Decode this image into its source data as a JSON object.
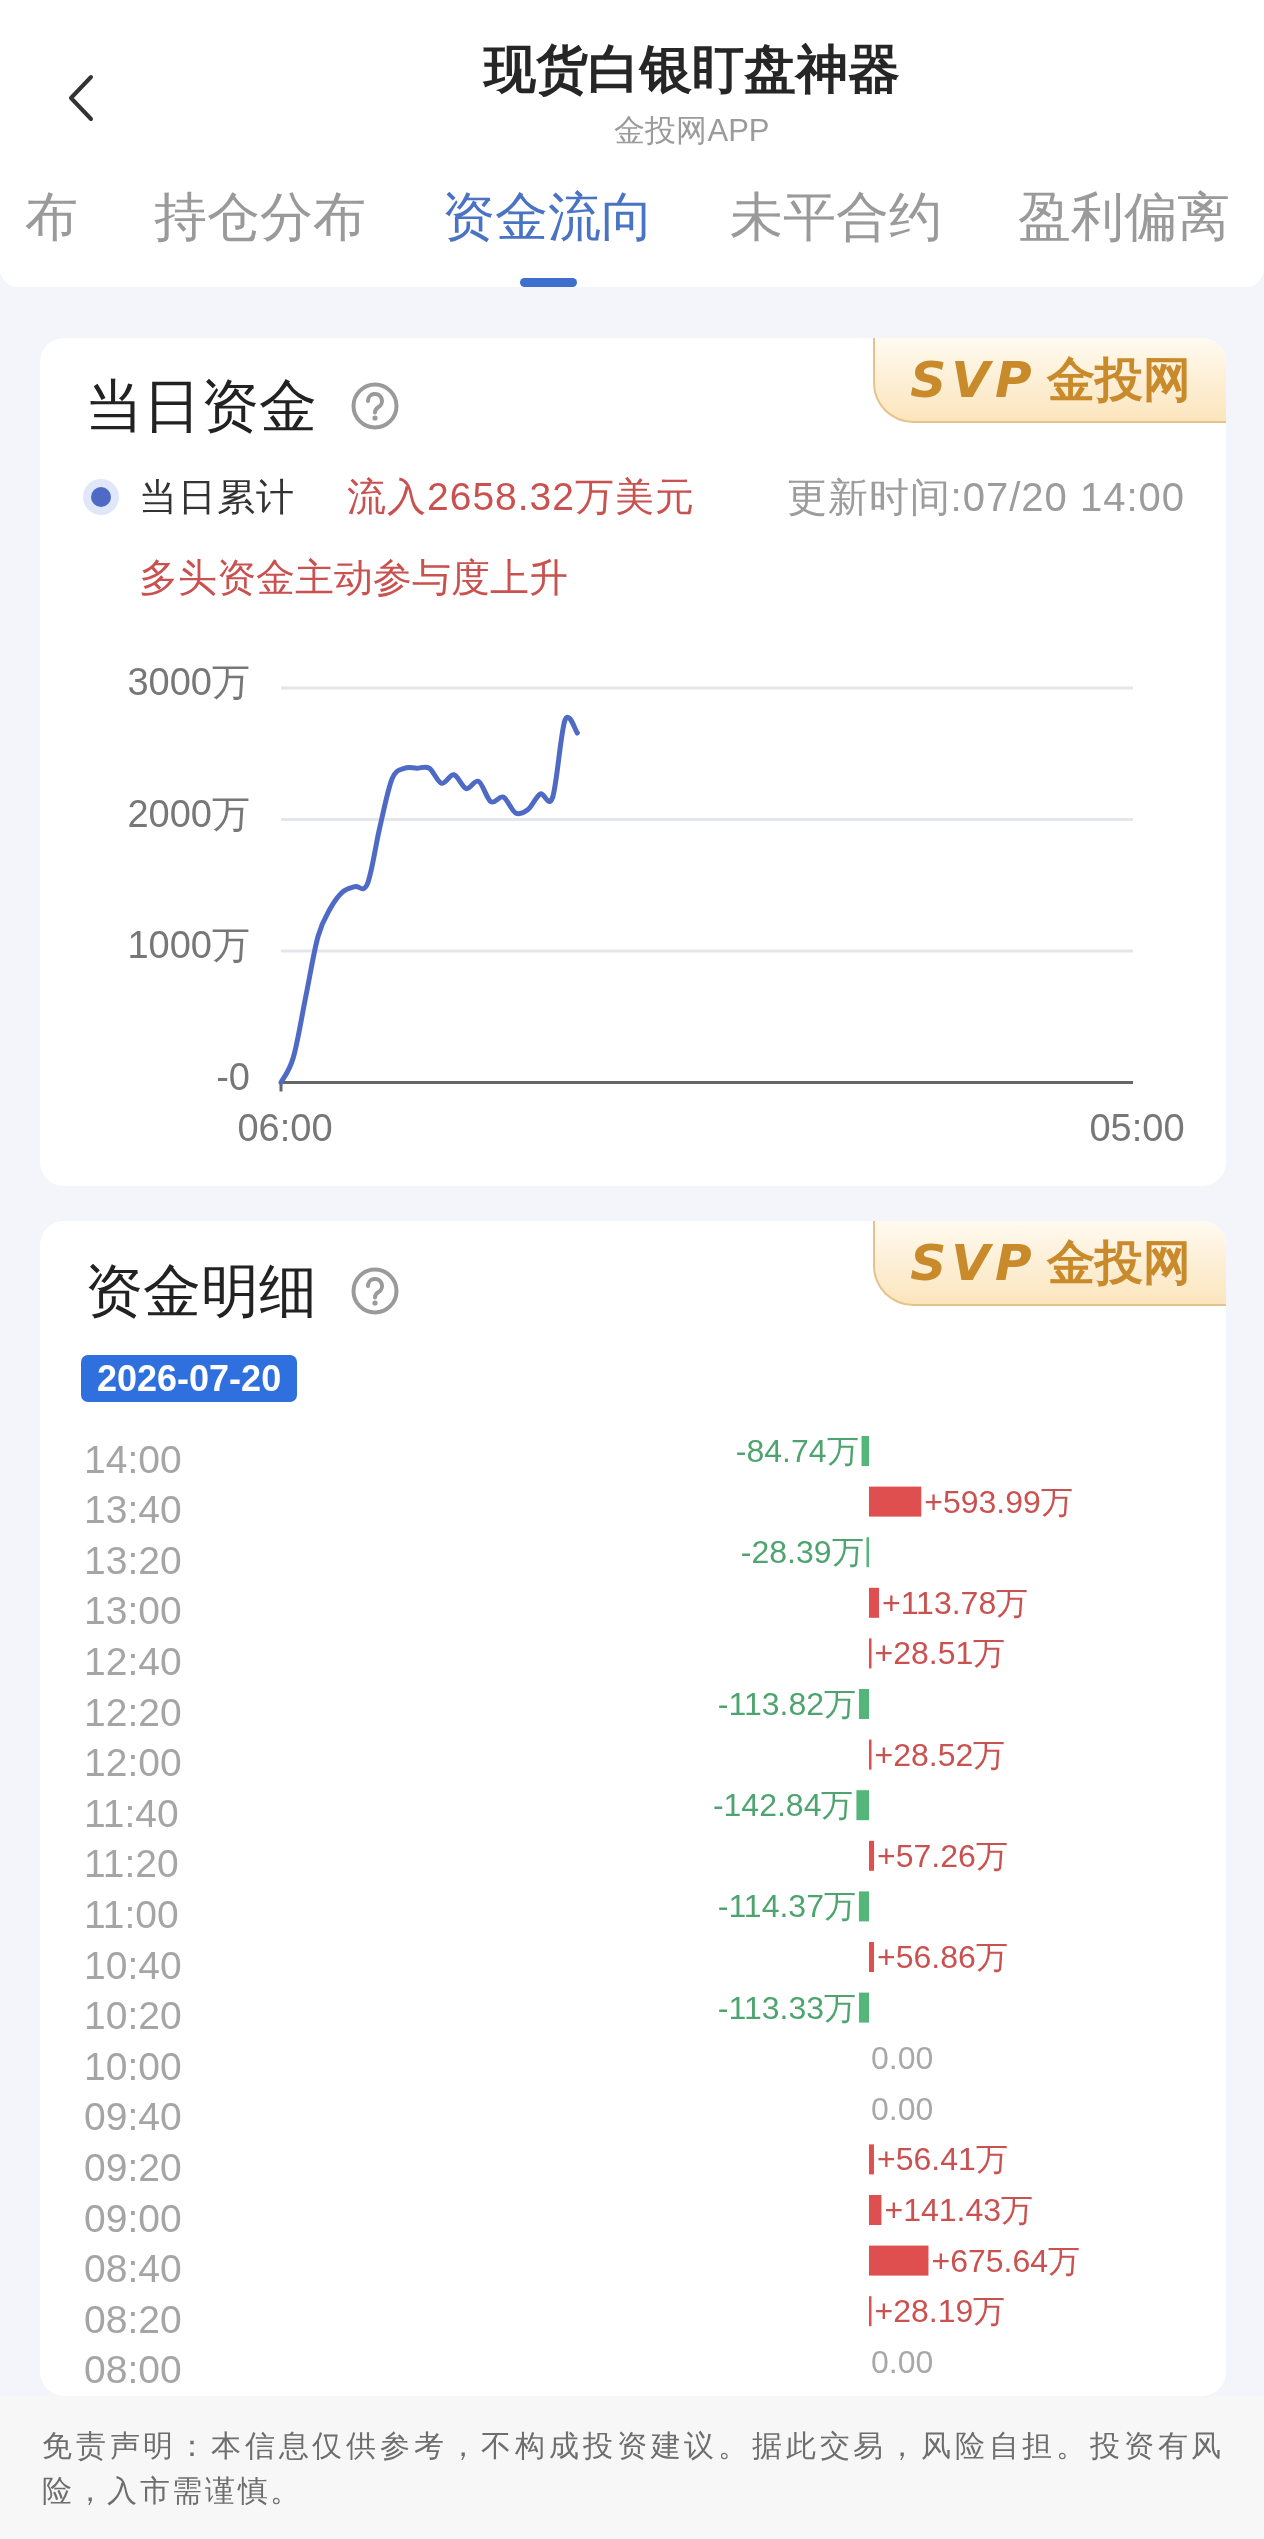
{
  "header": {
    "title": "现货白银盯盘神器",
    "subtitle": "金投网APP"
  },
  "tabs": [
    {
      "label": "布",
      "selected": false
    },
    {
      "label": "持仓分布",
      "selected": false
    },
    {
      "label": "资金流向",
      "selected": true
    },
    {
      "label": "未平合约",
      "selected": false
    },
    {
      "label": "盈利偏离",
      "selected": false
    }
  ],
  "daily_funds": {
    "title": "当日资金",
    "badge": {
      "logo": "SVP",
      "label": "金投网"
    },
    "amount": "流入2658.32万美元",
    "updated": "更新时间:07/20 14:00",
    "note": "多头资金主动参与度上升",
    "chart_data": {
      "type": "line",
      "categories": [
        "06:00",
        null,
        null,
        null,
        null,
        null,
        null,
        null,
        null,
        null,
        null,
        null,
        null,
        null,
        null,
        null,
        null,
        null,
        null,
        null,
        null,
        null,
        null,
        null,
        null,
        null,
        null,
        null,
        null,
        null,
        null,
        null,
        null,
        null,
        null,
        null,
        null,
        null,
        null,
        null,
        null,
        null,
        null,
        null,
        null,
        null,
        null,
        null,
        null,
        null,
        null,
        null,
        null,
        null,
        null,
        null,
        null,
        null,
        null,
        null,
        null,
        null,
        null,
        null,
        null,
        null,
        null,
        null,
        null,
        "05:00"
      ],
      "ylim": [
        0,
        3000
      ],
      "yticks": [
        {
          "value": 0,
          "label": "-0"
        },
        {
          "value": 1000,
          "label": "1000万"
        },
        {
          "value": 2000,
          "label": "2000万"
        },
        {
          "value": 3000,
          "label": "3000万"
        }
      ],
      "series": [
        {
          "name": "当日累计",
          "color": "#4f6ac4",
          "values": [
            0,
            190,
            650,
            1110,
            1325,
            1450,
            1490,
            1510,
            1940,
            2310,
            2390,
            2390,
            2390,
            2275,
            2340,
            2235,
            2290,
            2135,
            2170,
            2050,
            2075,
            2195,
            2170,
            2755,
            2658,
            null,
            null,
            null,
            null,
            null,
            null,
            null,
            null,
            null,
            null,
            null,
            null,
            null,
            null,
            null,
            null,
            null,
            null,
            null,
            null,
            null,
            null,
            null,
            null,
            null,
            null,
            null,
            null,
            null,
            null,
            null,
            null,
            null,
            null,
            null,
            null,
            null,
            null,
            null,
            null,
            null,
            null,
            null,
            null,
            null
          ]
        }
      ]
    }
  },
  "fund_details": {
    "title": "资金明细",
    "badge": {
      "logo": "SVP",
      "label": "金投网"
    },
    "date": "2026-07-20",
    "chart_data": {
      "type": "bar",
      "orientation": "horizontal",
      "categories": [
        "14:00",
        "13:40",
        "13:20",
        "13:00",
        "12:40",
        "12:20",
        "12:00",
        "11:40",
        "11:20",
        "11:00",
        "10:40",
        "10:20",
        "10:00",
        "09:40",
        "09:20",
        "09:00",
        "08:40",
        "08:20",
        "08:00"
      ],
      "series": [
        {
          "values": [
            -84.74,
            593.99,
            -28.39,
            113.78,
            28.51,
            -113.82,
            28.52,
            -142.84,
            57.26,
            -114.37,
            56.86,
            -113.33,
            0,
            0,
            56.41,
            141.43,
            675.64,
            28.19,
            0
          ],
          "value_labels": [
            "-84.74万",
            "+593.99万",
            "-28.39万",
            "+113.78万",
            "+28.51万",
            "-113.82万",
            "+28.52万",
            "-142.84万",
            "+57.26万",
            "-114.37万",
            "+56.86万",
            "-113.33万",
            "0.00",
            "0.00",
            "+56.41万",
            "+141.43万",
            "+675.64万",
            "+28.19万",
            "0.00"
          ]
        }
      ]
    }
  },
  "disclaimer": "免责声明：本信息仅供参考，不构成投资建议。据此交易，风险自担。投资有风险，入市需谨慎。"
}
